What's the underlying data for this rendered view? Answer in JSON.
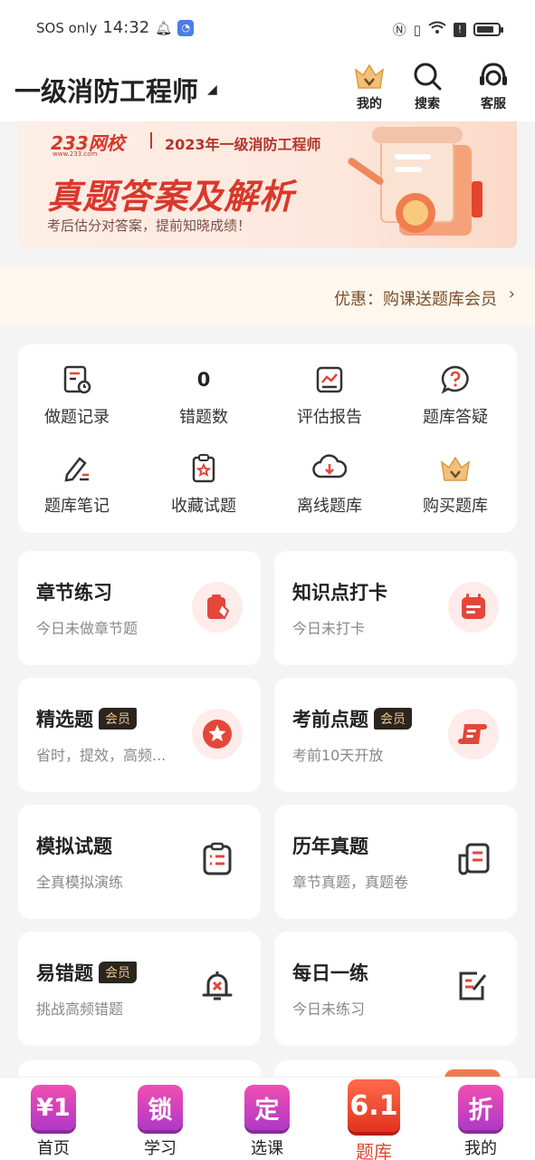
{
  "status_bar": {
    "carrier": "SOS only",
    "time": "14:32"
  },
  "header": {
    "title": "一级消防工程师",
    "buttons": {
      "mine": "我的",
      "search": "搜索",
      "service": "客服"
    }
  },
  "banner": {
    "logo": "233网校",
    "logo_sub": "www.233.com",
    "year_title": "2023年一级消防工程师",
    "main": "真题答案及解析",
    "sub": "考后估分对答案，提前知晓成绩！"
  },
  "promo": {
    "text": "优惠：购课送题库会员"
  },
  "grid": {
    "items": [
      {
        "label": "做题记录"
      },
      {
        "label": "错题数",
        "value": "0"
      },
      {
        "label": "评估报告"
      },
      {
        "label": "题库答疑"
      },
      {
        "label": "题库笔记"
      },
      {
        "label": "收藏试题"
      },
      {
        "label": "离线题库"
      },
      {
        "label": "购买题库"
      }
    ]
  },
  "vip_tag": "会员",
  "cards": [
    {
      "title": "章节练习",
      "sub": "今日未做章节题"
    },
    {
      "title": "知识点打卡",
      "sub": "今日未打卡"
    },
    {
      "title": "精选题",
      "sub": "省时，提效，高频...",
      "vip": true
    },
    {
      "title": "考前点题",
      "sub": "考前10天开放",
      "vip": true
    },
    {
      "title": "模拟试题",
      "sub": "全真模拟演练"
    },
    {
      "title": "历年真题",
      "sub": "章节真题，真题卷"
    },
    {
      "title": "易错题",
      "sub": "挑战高频错题",
      "vip": true
    },
    {
      "title": "每日一练",
      "sub": "今日未练习"
    }
  ],
  "bottom_nav": [
    {
      "badge": "¥1",
      "label": "首页"
    },
    {
      "badge": "锁",
      "label": "学习"
    },
    {
      "badge": "定",
      "label": "选课"
    },
    {
      "badge": "6.1",
      "label": "题库",
      "active": true
    },
    {
      "badge": "折",
      "label": "我的"
    }
  ],
  "colors": {
    "accent": "#e2473a",
    "promo_text": "#7a4f2c",
    "vip_bg": "#2b2520",
    "vip_text": "#e9c48d"
  }
}
